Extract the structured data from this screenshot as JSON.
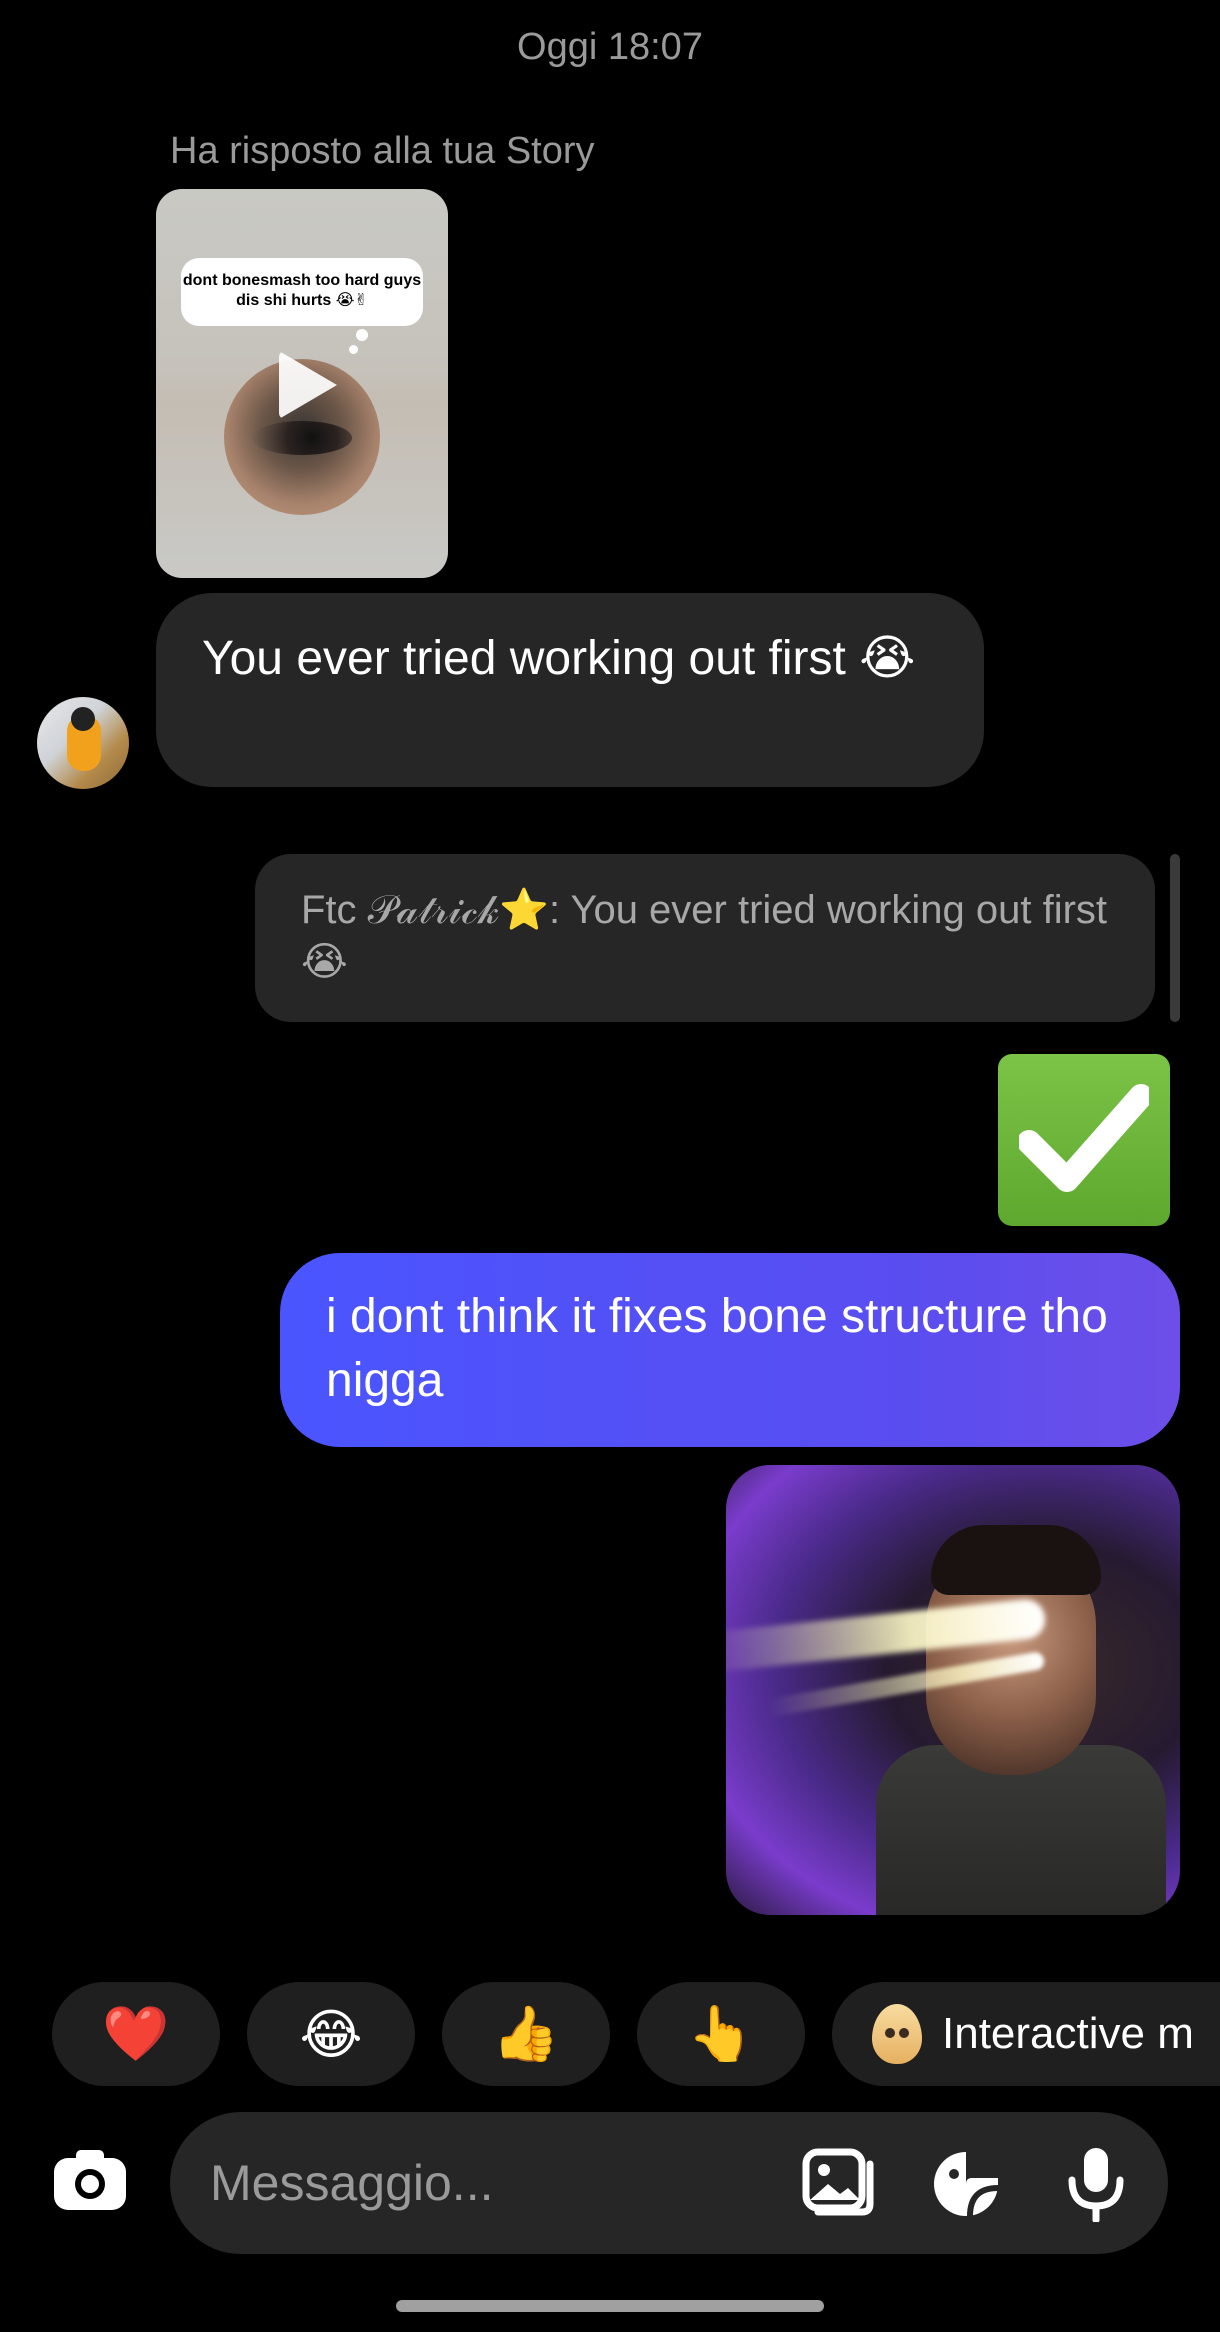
{
  "header": {
    "timestamp": "Oggi 18:07"
  },
  "story_reply": {
    "caption": "Ha risposto alla tua Story",
    "sticker_text": "dont bonesmash too hard guys dis shi hurts 😭✌"
  },
  "messages": {
    "incoming_text": "You ever tried working out first 😭",
    "reply_quote": "Ftc 𝒫𝒶𝓉𝓇𝒾𝒸𝓀⭐: You ever tried working out first 😭",
    "check_emoji": "✅",
    "outgoing_text": "i dont think it fixes bone structure tho nigga"
  },
  "quick_reactions": {
    "items": [
      "❤️",
      "😂",
      "👍",
      "👆"
    ],
    "interactive_label": "Interactive m"
  },
  "composer": {
    "placeholder": "Messaggio...",
    "icons": [
      "camera-icon",
      "gallery-icon",
      "sticker-icon",
      "microphone-icon"
    ]
  },
  "colors": {
    "background": "#000000",
    "incoming_bubble": "#262626",
    "outgoing_bubble": "#4a55ff",
    "muted_text": "#9a9a9a"
  }
}
